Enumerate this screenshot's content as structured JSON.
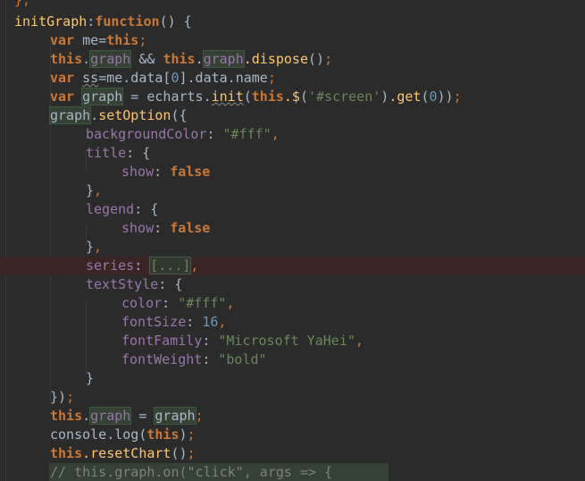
{
  "editor": {
    "lines": [
      "},",
      "initGraph:function() {",
      "var me=this;",
      "this.graph && this.graph.dispose();",
      "var ss=me.data[0].data.name;",
      "var graph = echarts.init(this.$('#screen').get(0));",
      "graph.setOption({",
      "backgroundColor: \"#fff\",",
      "title: {",
      "show: false",
      "},",
      "legend: {",
      "show: false",
      "},",
      "series: [...],",
      "textStyle: {",
      "color: \"#fff\",",
      "fontSize: 16,",
      "fontFamily: \"Microsoft YaHei\",",
      "fontWeight: \"bold\"",
      "}",
      "});",
      "this.graph = graph;",
      "console.log(this);",
      "this.resetChart();",
      "// this.graph.on(\"click\", args => {"
    ],
    "tokens": {
      "l0_close": "},",
      "l1_name": "initGraph",
      "l1_colon": ":",
      "l1_kw": "function",
      "l1_rest": "() {",
      "l2_kw": "var",
      "l2_id": "me",
      "l2_eq": "=",
      "l2_this": "this",
      "l2_semi": ";",
      "l3_this1": "this",
      "l3_dot1": ".",
      "l3_graph1": "graph",
      "l3_and": " && ",
      "l3_this2": "this",
      "l3_dot2": ".",
      "l3_graph2": "graph",
      "l3_dispose": ".dispose",
      "l3_call": "()",
      "l3_semi": ";",
      "l4_kw": "var",
      "l4_ss": "ss",
      "l4_rhs": "=me.data[",
      "l4_num": "0",
      "l4_rhs2": "].data.name",
      "l4_semi": ";",
      "l5_kw": "var",
      "l5_graph": "graph",
      "l5_eq": " = echarts.",
      "l5_init": "init",
      "l5_p1": "(",
      "l5_this": "this",
      "l5_dollar": ".$",
      "l5_p2": "(",
      "l5_str": "'#screen'",
      "l5_p3": ")",
      "l5_get": ".get",
      "l5_p4": "(",
      "l5_num": "0",
      "l5_p5": "))",
      "l5_semi": ";",
      "l6_graph": "graph",
      "l6_dot": ".",
      "l6_fn": "setOption",
      "l6_rest": "({",
      "l7_prop": "backgroundColor",
      "l7_colon": ": ",
      "l7_str": "\"#fff\"",
      "l7_comma": ",",
      "l8_prop": "title",
      "l8_rest": ": {",
      "l9_prop": "show",
      "l9_colon": ": ",
      "l9_kw": "false",
      "l10_close": "}",
      "l10_comma": ",",
      "l11_prop": "legend",
      "l11_rest": ": {",
      "l12_prop": "show",
      "l12_colon": ": ",
      "l12_kw": "false",
      "l13_close": "}",
      "l13_comma": ",",
      "l14_prop": "series",
      "l14_colon": ": ",
      "l14_fold": "[...]",
      "l14_comma": ",",
      "l15_prop": "textStyle",
      "l15_rest": ": {",
      "l16_prop": "color",
      "l16_colon": ": ",
      "l16_str": "\"#fff\"",
      "l16_comma": ",",
      "l17_prop": "fontSize",
      "l17_colon": ": ",
      "l17_num": "16",
      "l17_comma": ",",
      "l18_prop": "fontFamily",
      "l18_colon": ": ",
      "l18_str": "\"Microsoft YaHei\"",
      "l18_comma": ",",
      "l19_prop": "fontWeight",
      "l19_colon": ": ",
      "l19_str": "\"bold\"",
      "l20_close": "}",
      "l21_close": "})",
      "l21_semi": ";",
      "l22_this": "this",
      "l22_dot": ".",
      "l22_graph1": "graph",
      "l22_eq": " = ",
      "l22_graph2": "graph",
      "l22_semi": ";",
      "l23_console": "console",
      "l23_log": ".log(",
      "l23_this": "this",
      "l23_close": ")",
      "l23_semi": ";",
      "l24_this": "this",
      "l24_reset": ".resetChart",
      "l24_call": "()",
      "l24_semi": ";",
      "l25_comment": "// this.graph.on(\"click\", args => {"
    }
  },
  "colors": {
    "background": "#2b2b2b",
    "keyword": "#cc7832",
    "function": "#ffc66d",
    "property": "#9876aa",
    "string": "#6a8759",
    "number": "#6897bb",
    "text": "#a9b7c6",
    "highlight": "#344134",
    "error_line": "#3b2424"
  }
}
